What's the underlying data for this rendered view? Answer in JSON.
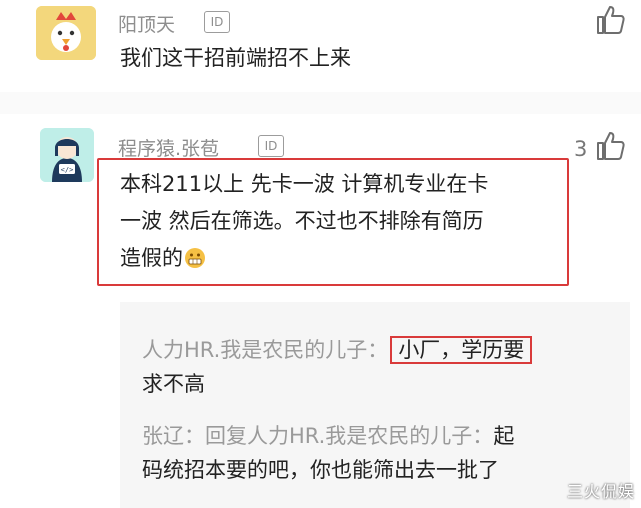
{
  "comments": [
    {
      "username": "阳顶天",
      "id_badge": "ID",
      "text": "我们这干招前端招不上来",
      "like_count": ""
    },
    {
      "username": "程序猿.张苞",
      "id_badge": "ID",
      "text_line1": "本科211以上 先卡一波 计算机专业在卡",
      "text_line2": "一波 然后在筛选。不过也不排除有简历",
      "text_line3": "造假的",
      "like_count": "3"
    }
  ],
  "replies": [
    {
      "author": "人力HR.我是农民的儿子：",
      "text_boxed": "小厂，学历要",
      "text_rest": "求不高"
    },
    {
      "author": "张辽：回复人力HR.我是农民的儿子：",
      "text_tail": "起",
      "text_line2": "码统招本要的吧，你也能筛出去一批了"
    }
  ],
  "watermark": "三火侃娱",
  "colors": {
    "highlight": "#d93a3a",
    "muted": "#8e8e8e",
    "reply_bg": "#f6f6f6"
  },
  "icons": [
    "chicken-avatar",
    "programmer-avatar",
    "thumbs-up-icon",
    "grimace-emoji"
  ]
}
